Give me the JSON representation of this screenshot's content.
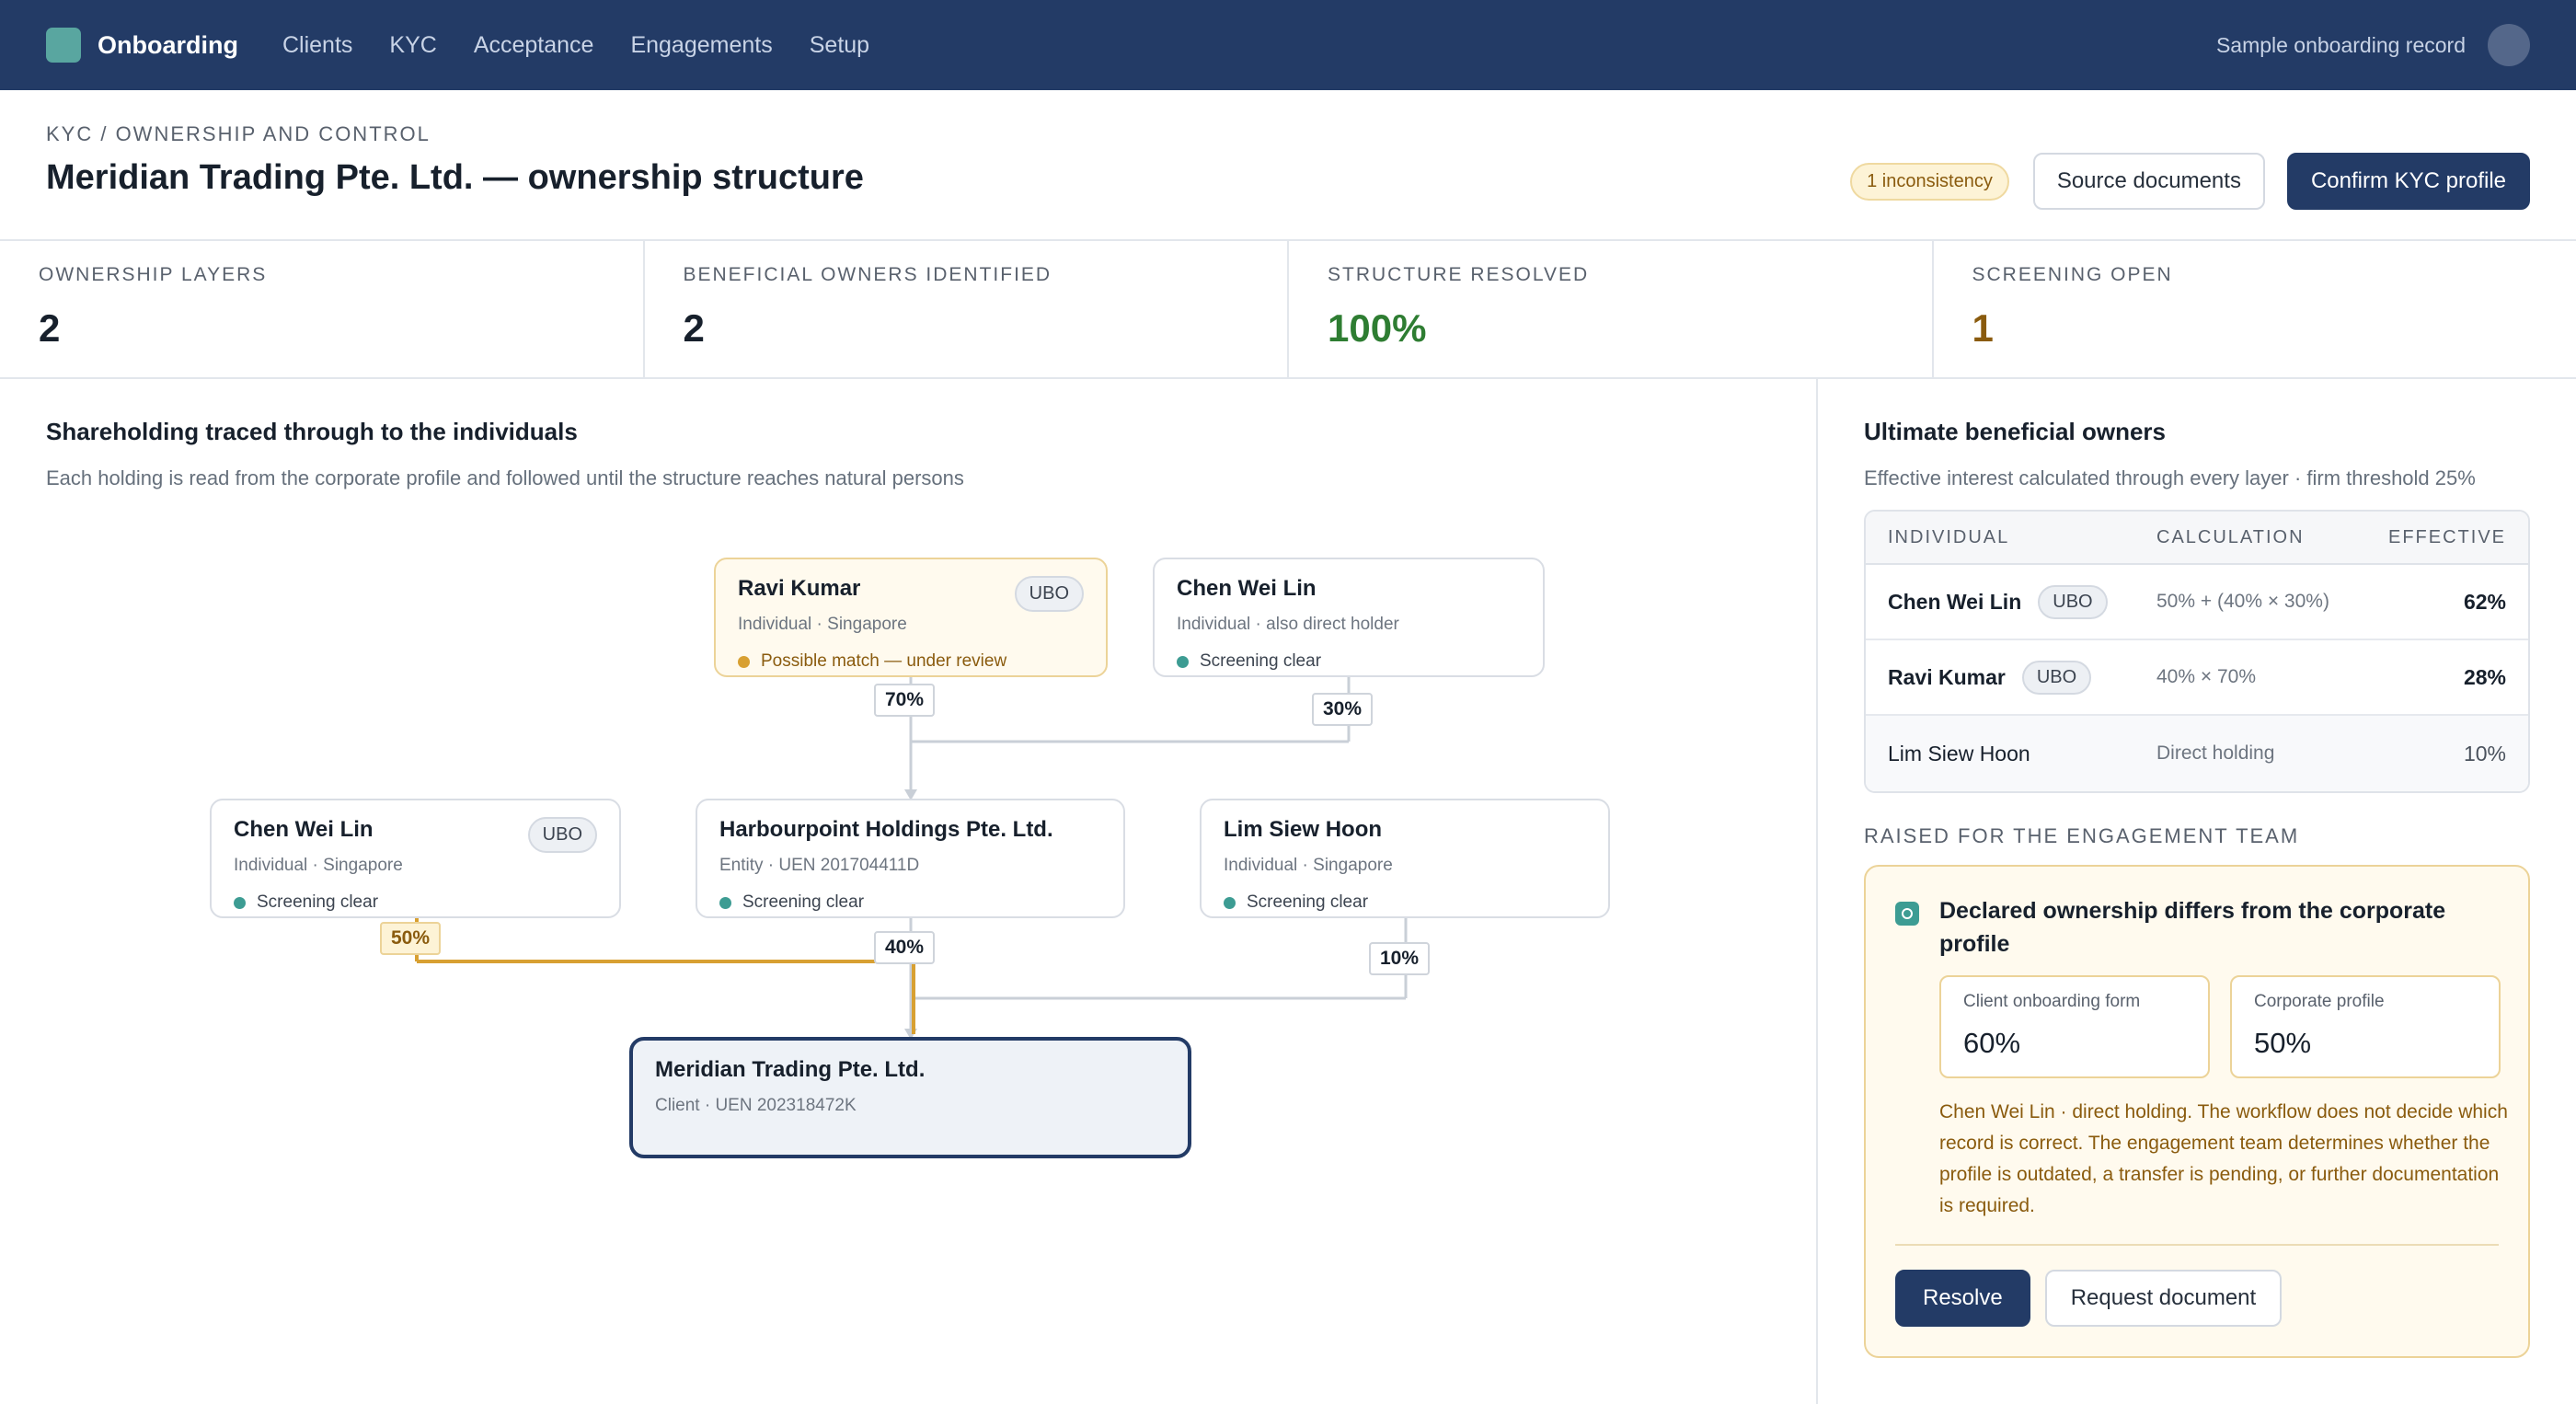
{
  "nav": {
    "brand": "Onboarding",
    "items": [
      "Clients",
      "KYC",
      "Acceptance",
      "Engagements",
      "Setup"
    ],
    "record_label": "Sample onboarding record"
  },
  "header": {
    "breadcrumb": "KYC / OWNERSHIP AND CONTROL",
    "title": "Meridian Trading Pte. Ltd. — ownership structure",
    "inconsistency_badge": "1 inconsistency",
    "source_button": "Source documents",
    "confirm_button": "Confirm KYC profile"
  },
  "metrics": [
    {
      "label": "OWNERSHIP LAYERS",
      "value": "2"
    },
    {
      "label": "BENEFICIAL OWNERS IDENTIFIED",
      "value": "2"
    },
    {
      "label": "STRUCTURE RESOLVED",
      "value": "100%"
    },
    {
      "label": "SCREENING OPEN",
      "value": "1"
    }
  ],
  "structure": {
    "title": "Shareholding traced through to the individuals",
    "subtitle": "Each holding is read from the corporate profile and followed until the structure reaches natural persons",
    "nodes": {
      "ravi": {
        "name": "Ravi Kumar",
        "meta": "Individual · Singapore",
        "status": "Possible match — under review",
        "tag": "UBO"
      },
      "chen_top": {
        "name": "Chen Wei Lin",
        "meta": "Individual · also direct holder",
        "status": "Screening clear"
      },
      "chen_left": {
        "name": "Chen Wei Lin",
        "meta": "Individual · Singapore",
        "status": "Screening clear",
        "tag": "UBO"
      },
      "harbour": {
        "name": "Harbourpoint Holdings Pte. Ltd.",
        "meta": "Entity · UEN 201704411D",
        "status": "Screening clear"
      },
      "lim": {
        "name": "Lim Siew Hoon",
        "meta": "Individual · Singapore",
        "status": "Screening clear"
      },
      "client": {
        "name": "Meridian Trading Pte. Ltd.",
        "meta": "Client · UEN 202318472K"
      }
    },
    "percents": {
      "ravi_to_harbour": "70%",
      "chen_to_harbour": "30%",
      "chen_to_client": "50%",
      "harbour_to_client": "40%",
      "lim_to_client": "10%"
    }
  },
  "ubo": {
    "title": "Ultimate beneficial owners",
    "subtitle": "Effective interest calculated through every layer · firm threshold 25%",
    "headers": {
      "individual": "INDIVIDUAL",
      "calculation": "CALCULATION",
      "effective": "EFFECTIVE"
    },
    "rows": [
      {
        "name": "Chen Wei Lin",
        "tag": "UBO",
        "calc": "50% + (40% × 30%)",
        "effective": "62%"
      },
      {
        "name": "Ravi Kumar",
        "tag": "UBO",
        "calc": "40% × 70%",
        "effective": "28%"
      },
      {
        "name": "Lim Siew Hoon",
        "calc": "Direct holding",
        "effective": "10%"
      }
    ]
  },
  "issue": {
    "section_label": "RAISED FOR THE ENGAGEMENT TEAM",
    "title": "Declared ownership differs from the corporate profile",
    "form_label": "Client onboarding form",
    "form_value": "60%",
    "profile_label": "Corporate profile",
    "profile_value": "50%",
    "text": "Chen Wei Lin · direct holding. The workflow does not decide which record is correct. The engagement team determines whether the profile is outdated, a transfer is pending, or further documentation is required.",
    "resolve_button": "Resolve",
    "request_button": "Request document"
  },
  "colors": {
    "navy": "#233b66",
    "teal": "#59a6a0",
    "amber": "#d8a032",
    "green": "#2e7d32"
  }
}
